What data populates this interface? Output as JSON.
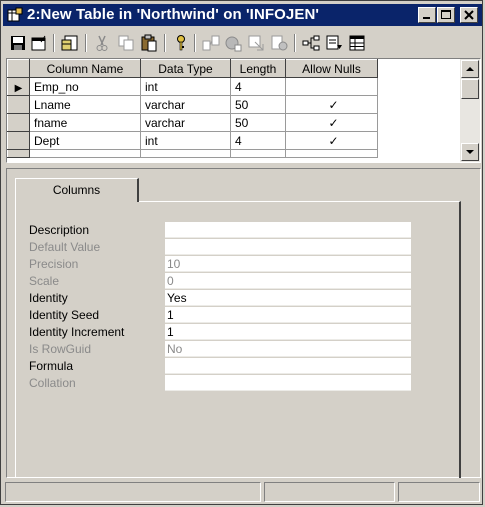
{
  "window": {
    "title": "2:New Table in 'Northwind' on 'INFOJEN'",
    "controls": [
      "minimize-icon",
      "maximize-icon",
      "close-icon"
    ]
  },
  "toolbar": {
    "icons": [
      "save-icon",
      "properties-icon",
      "manage-table-icon",
      "cut-icon",
      "copy-icon",
      "paste-icon",
      "set-primary-key-icon",
      "manage-relationships-icon",
      "manage-indexes-icon",
      "manage-constraints-icon",
      "generate-script-icon",
      "diagram-icon",
      "change-type-icon",
      "grid-icon"
    ]
  },
  "grid": {
    "columns": [
      "Column Name",
      "Data Type",
      "Length",
      "Allow Nulls"
    ],
    "rows": [
      {
        "name": "Emp_no",
        "type": "int",
        "length": "4",
        "nulls": ""
      },
      {
        "name": "Lname",
        "type": "varchar",
        "length": "50",
        "nulls": "✓"
      },
      {
        "name": "fname",
        "type": "varchar",
        "length": "50",
        "nulls": "✓"
      },
      {
        "name": "Dept",
        "type": "int",
        "length": "4",
        "nulls": "✓"
      },
      {
        "name": "",
        "type": "",
        "length": "",
        "nulls": ""
      }
    ],
    "current_row_marker": "▶"
  },
  "properties": {
    "tab_label": "Columns",
    "rows": [
      {
        "label": "Description",
        "value": "",
        "enabled": true
      },
      {
        "label": "Default Value",
        "value": "",
        "enabled": false
      },
      {
        "label": "Precision",
        "value": "10",
        "enabled": false
      },
      {
        "label": "Scale",
        "value": "0",
        "enabled": false
      },
      {
        "label": "Identity",
        "value": "Yes",
        "enabled": true
      },
      {
        "label": "Identity Seed",
        "value": "1",
        "enabled": true
      },
      {
        "label": "Identity Increment",
        "value": "1",
        "enabled": true
      },
      {
        "label": "Is RowGuid",
        "value": "No",
        "enabled": false
      },
      {
        "label": "Formula",
        "value": "",
        "enabled": true
      },
      {
        "label": "Collation",
        "value": "",
        "enabled": false
      }
    ]
  },
  "colors": {
    "titlebar": "#0a246a",
    "face": "#d4d0c8"
  }
}
